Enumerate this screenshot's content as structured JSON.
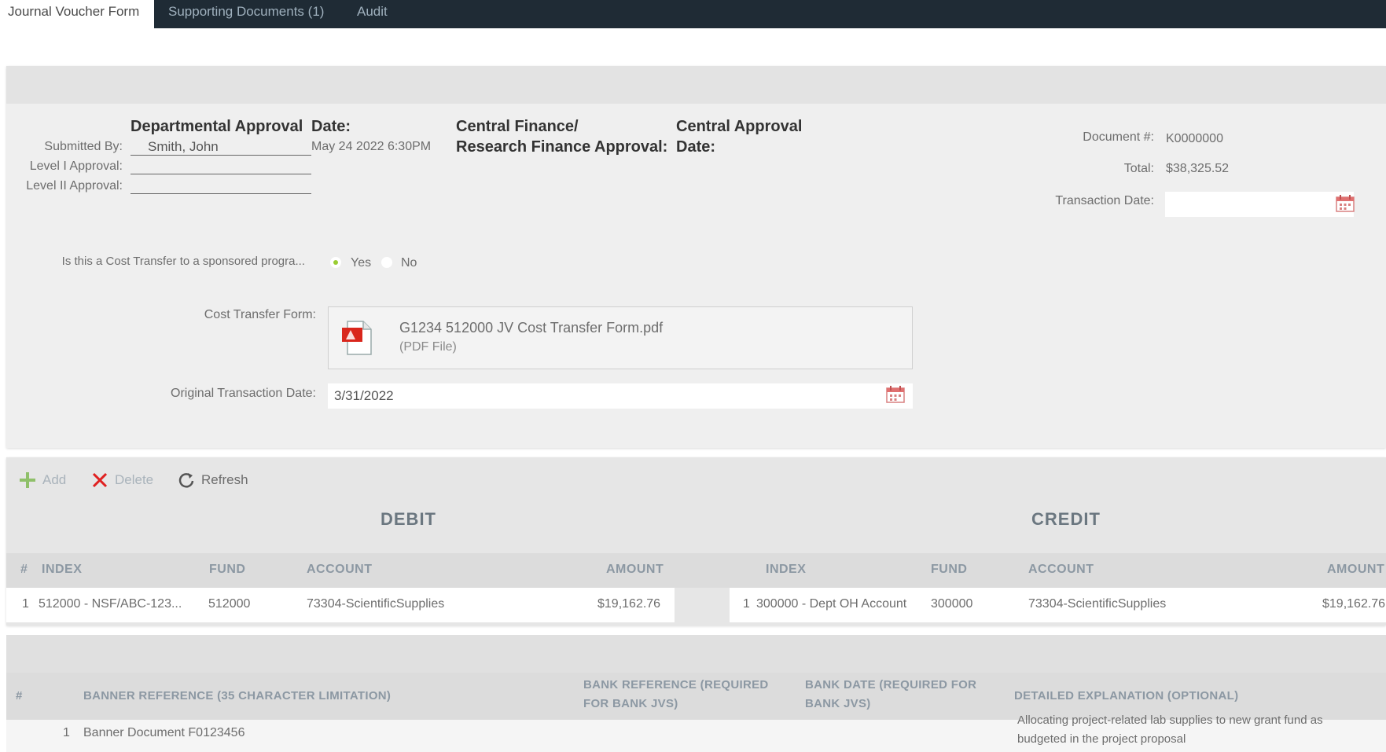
{
  "tabs": [
    {
      "label": "Journal Voucher Form",
      "active": true
    },
    {
      "label": "Supporting Documents (1)",
      "active": false
    },
    {
      "label": "Audit",
      "active": false
    }
  ],
  "approvals": {
    "departmental_header": "Departmental Approval",
    "date_header": "Date:",
    "central_finance_header_1": "Central Finance/",
    "central_finance_header_2": "Research Finance Approval:",
    "central_approval_header_1": "Central Approval",
    "central_approval_header_2": "Date:",
    "submitted_by_label": "Submitted By:",
    "submitted_by_value": "Smith, John",
    "submitted_date": "May 24 2022  6:30PM",
    "level1_label": "Level I Approval:",
    "level2_label": "Level II Approval:"
  },
  "document": {
    "doc_label": "Document #:",
    "doc_value": "K0000000",
    "total_label": "Total:",
    "total_value": "$38,325.52",
    "transaction_date_label": "Transaction Date:",
    "transaction_date_value": ""
  },
  "cost_transfer": {
    "question": "Is this a Cost Transfer to a sponsored progra...",
    "yes_label": "Yes",
    "no_label": "No",
    "selected": "Yes",
    "form_label": "Cost Transfer Form:",
    "file_name": "G1234 512000 JV Cost Transfer Form.pdf",
    "file_type": "(PDF File)",
    "orig_date_label": "Original Transaction Date:",
    "orig_date_value": "3/31/2022"
  },
  "toolbar": {
    "add": "Add",
    "delete": "Delete",
    "refresh": "Refresh"
  },
  "grid": {
    "debit_title": "DEBIT",
    "credit_title": "CREDIT",
    "columns": {
      "num": "#",
      "debit_index": "INDEX",
      "debit_fund": "FUND",
      "debit_account": "ACCOUNT",
      "debit_amount": "AMOUNT",
      "credit_index": "INDEX",
      "credit_fund": "FUND",
      "credit_account": "ACCOUNT",
      "credit_amount": "AMOUNT"
    },
    "rows": [
      {
        "num": "1",
        "debit_index": "512000 - NSF/ABC-123...",
        "debit_fund": "512000",
        "debit_account": "73304-ScientificSupplies",
        "debit_amount": "$19,162.76",
        "credit_num": "1",
        "credit_index": "300000 - Dept OH Account",
        "credit_fund": "300000",
        "credit_account": "73304-ScientificSupplies",
        "credit_amount": "$19,162.76"
      }
    ]
  },
  "references": {
    "columns": {
      "num": "#",
      "banner": "BANNER REFERENCE (35 CHARACTER LIMITATION)",
      "bank_ref_1": "BANK REFERENCE (REQUIRED",
      "bank_ref_2": "FOR BANK JVS)",
      "bank_date_1": "BANK DATE (REQUIRED FOR",
      "bank_date_2": "BANK JVS)",
      "explanation": "DETAILED EXPLANATION (OPTIONAL)"
    },
    "rows": [
      {
        "num": "1",
        "banner": "Banner Document F0123456",
        "bank_ref": "",
        "bank_date": "",
        "explanation_1": "Allocating project-related lab supplies to new grant fund as",
        "explanation_2": "budgeted in the project proposal"
      }
    ]
  },
  "colors": {
    "tabbar": "#1f2b35",
    "radio_selected": "#9acd32",
    "delete_icon": "#e02020",
    "add_icon": "#8fc06a",
    "pdf_red": "#d9261c"
  }
}
